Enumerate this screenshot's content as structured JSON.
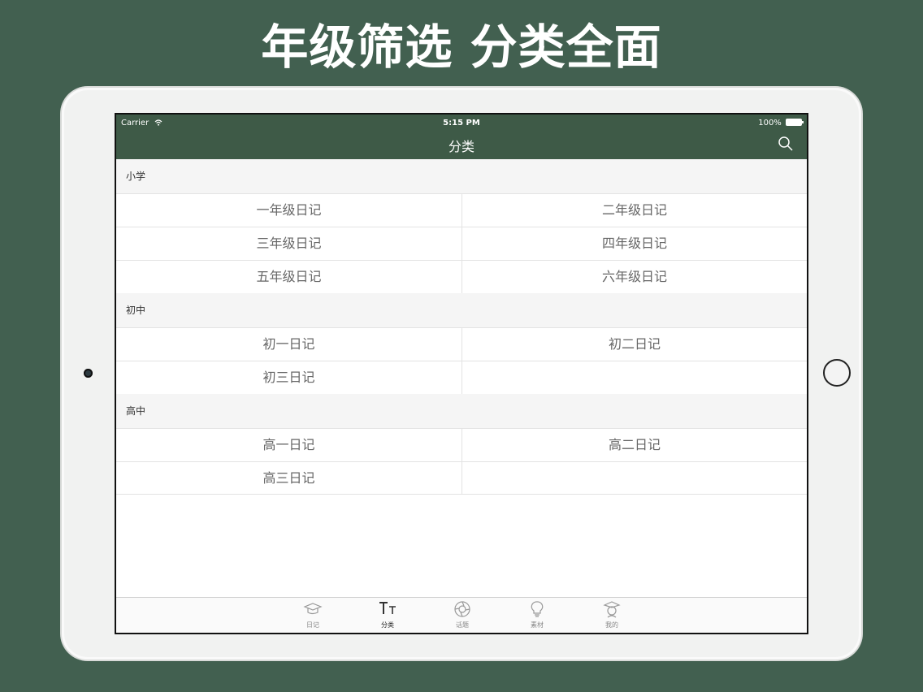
{
  "promo": {
    "title": "年级筛选 分类全面"
  },
  "status_bar": {
    "carrier": "Carrier",
    "time": "5:15 PM",
    "battery": "100%"
  },
  "nav": {
    "title": "分类",
    "search_icon": "search-icon"
  },
  "sections": [
    {
      "title": "小学",
      "rows": [
        [
          "一年级日记",
          "二年级日记"
        ],
        [
          "三年级日记",
          "四年级日记"
        ],
        [
          "五年级日记",
          "六年级日记"
        ]
      ]
    },
    {
      "title": "初中",
      "rows": [
        [
          "初一日记",
          "初二日记"
        ],
        [
          "初三日记",
          ""
        ]
      ]
    },
    {
      "title": "高中",
      "rows": [
        [
          "高一日记",
          "高二日记"
        ],
        [
          "高三日记",
          ""
        ]
      ]
    }
  ],
  "tabs": [
    {
      "label": "日记",
      "icon": "graduation-cap-icon",
      "active": false
    },
    {
      "label": "分类",
      "icon": "text-size-icon",
      "active": true
    },
    {
      "label": "话题",
      "icon": "aperture-icon",
      "active": false
    },
    {
      "label": "素材",
      "icon": "lightbulb-icon",
      "active": false
    },
    {
      "label": "我的",
      "icon": "student-avatar-icon",
      "active": false
    }
  ],
  "colors": {
    "background": "#426050",
    "navbar": "#3e5a47",
    "section_header_bg": "#f5f5f5",
    "cell_text": "#666666"
  }
}
